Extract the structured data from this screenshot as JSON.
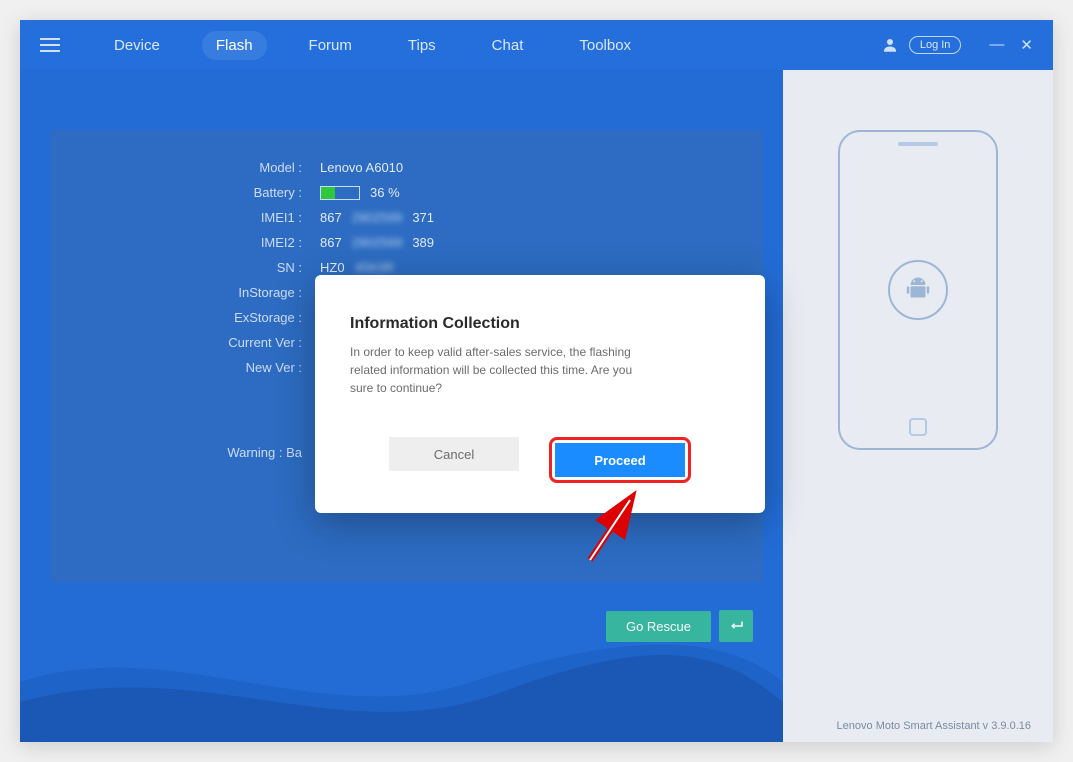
{
  "nav": {
    "items": [
      "Device",
      "Flash",
      "Forum",
      "Tips",
      "Chat",
      "Toolbox"
    ],
    "active_index": 1,
    "login": "Log In"
  },
  "device": {
    "labels": {
      "model": "Model :",
      "battery": "Battery :",
      "imei1": "IMEI1 :",
      "imei2": "IMEI2 :",
      "sn": "SN :",
      "instorage": "InStorage :",
      "exstorage": "ExStorage :",
      "current_ver": "Current Ver :",
      "new_ver": "New Ver :",
      "warning": "Warning : Ba"
    },
    "values": {
      "model": "Lenovo A6010",
      "battery_pct": "36 %",
      "imei1_prefix": "867",
      "imei1_mask": "2902599",
      "imei1_suffix": "371",
      "imei2_prefix": "867",
      "imei2_mask": "2902599",
      "imei2_suffix": "389",
      "sn_prefix": "HZ0",
      "sn_mask": "45K0R"
    }
  },
  "dialog": {
    "title": "Information Collection",
    "text": "In order to keep valid after-sales service, the flashing related information will be collected this time. Are you sure to continue?",
    "cancel": "Cancel",
    "proceed": "Proceed"
  },
  "actions": {
    "go_rescue": "Go Rescue"
  },
  "footer": "Lenovo Moto Smart Assistant v 3.9.0.16"
}
